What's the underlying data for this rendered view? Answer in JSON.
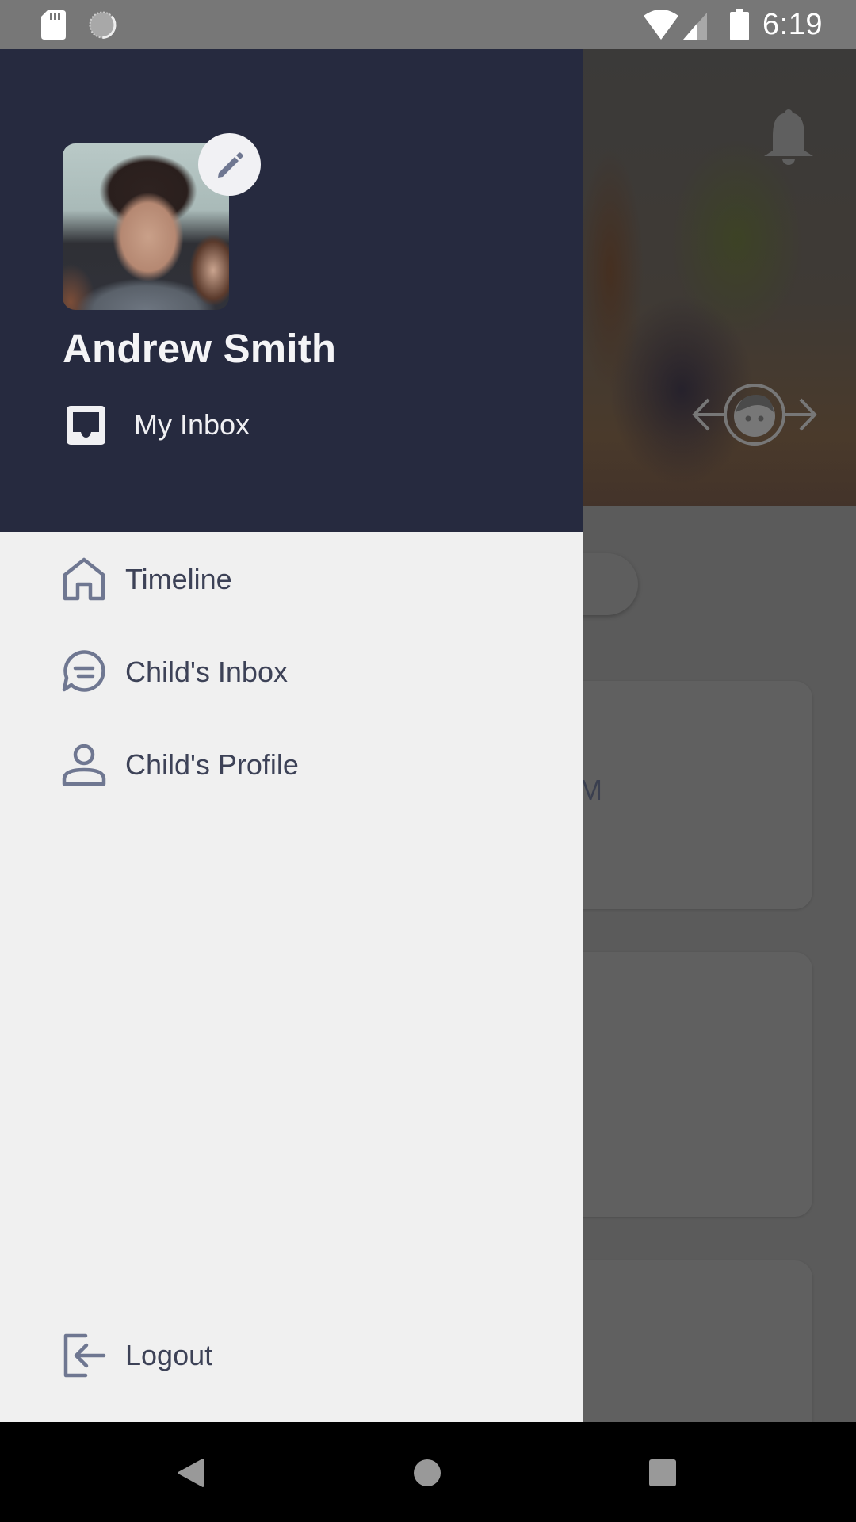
{
  "status_bar": {
    "time": "6:19",
    "icons": [
      "sd-card-icon",
      "sync-icon",
      "wifi-icon",
      "signal-icon",
      "battery-icon"
    ]
  },
  "drawer": {
    "user": {
      "name": "Andrew Smith",
      "avatar_alt": "Profile photo of Andrew Smith",
      "edit_icon": "pencil-icon"
    },
    "header_link": {
      "label": "My Inbox",
      "icon": "inbox-icon"
    },
    "items": [
      {
        "label": "Timeline",
        "icon": "home-icon"
      },
      {
        "label": "Child's Inbox",
        "icon": "chat-bubble-icon"
      },
      {
        "label": "Child's Profile",
        "icon": "person-icon"
      }
    ],
    "footer_item": {
      "label": "Logout",
      "icon": "logout-icon"
    }
  },
  "background_app": {
    "header_icons": [
      "bell-icon",
      "child-switch-icon"
    ],
    "card_partial_text": "M"
  },
  "colors": {
    "drawer_header": "#262a3f",
    "drawer_body": "#f0f0f0",
    "icon_accent": "#6f7791",
    "text_dark": "#3d4257",
    "scrim": "#5b5b5b"
  },
  "nav_bar": {
    "buttons": [
      "back",
      "home",
      "recents"
    ]
  }
}
